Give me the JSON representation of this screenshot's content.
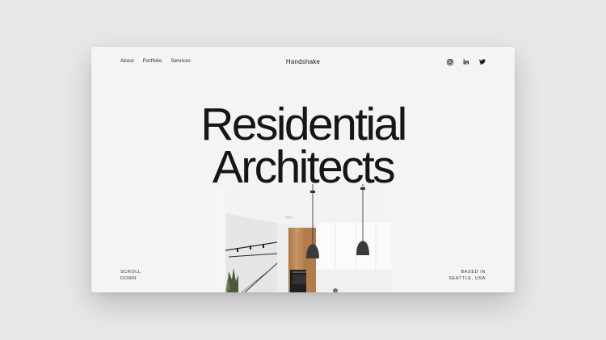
{
  "nav": {
    "items": [
      "About",
      "Portfolio",
      "Services"
    ]
  },
  "brand": "Handshake",
  "social": [
    "instagram-icon",
    "linkedin-icon",
    "twitter-icon"
  ],
  "hero": {
    "line1": "Residential",
    "line2": "Architects"
  },
  "footer": {
    "scroll_line1": "SCROLL",
    "scroll_line2": "DOWN",
    "based_line1": "BASED IN",
    "based_line2": "SEATTLE, USA"
  },
  "colors": {
    "background": "#e8e8e8",
    "card": "#f4f4f4",
    "text": "#161616"
  }
}
